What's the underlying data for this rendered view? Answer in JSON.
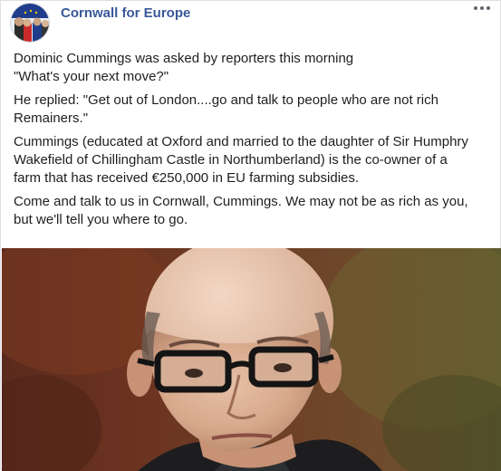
{
  "post": {
    "page_name": "Cornwall for Europe",
    "more_icon": "more-horizontal-icon",
    "paragraphs": [
      {
        "lines": [
          "Dominic Cummings was asked by reporters this morning",
          "\"What's your next move?\""
        ]
      },
      {
        "lines": [
          "He replied: \"Get out of London....go and talk to people who are not rich",
          "Remainers.\""
        ]
      },
      {
        "lines": [
          "Cummings (educated at Oxford and married to the daughter of Sir Humphry",
          "Wakefield of Chillingham Castle in Northumberland) is the co-owner of a",
          "farm that has received €250,000 in EU farming subsidies."
        ]
      },
      {
        "lines": [
          "Come and talk to us in Cornwall, Cummings. We may not be as rich as you,",
          "but we'll tell you where to go."
        ]
      }
    ]
  },
  "colors": {
    "page_name": "#385898",
    "text": "#1c1e21",
    "border": "#dddfe2"
  }
}
